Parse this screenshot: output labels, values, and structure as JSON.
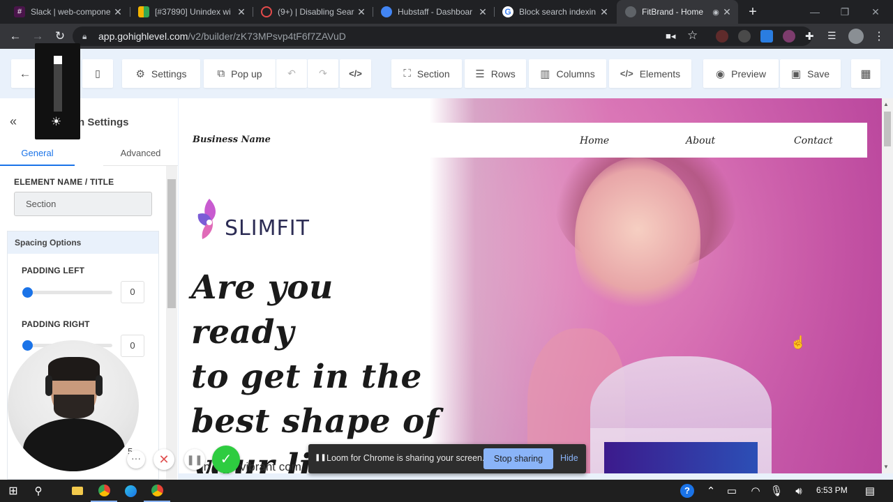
{
  "browser": {
    "tabs": [
      {
        "title": "Slack | web-compone",
        "favicon_color": "#4a154b",
        "active": false
      },
      {
        "title": "[#37890] Unindex wi",
        "favicon_color": "#f4b400",
        "active": false
      },
      {
        "title": "(9+) | Disabling Sear",
        "favicon_color": "#e54b4b",
        "active": false
      },
      {
        "title": "Hubstaff - Dashboar",
        "favicon_color": "#4285f4",
        "active": false
      },
      {
        "title": "Block search indexin",
        "favicon_color": "#ffffff",
        "active": false
      },
      {
        "title": "FitBrand - Home",
        "favicon_color": "#9aa0a6",
        "active": true
      }
    ],
    "url_host": "app.gohighlevel.com",
    "url_path": "/v2/builder/zK73MPsvp4tF6f7ZAVuD"
  },
  "toolbar": {
    "settings": "Settings",
    "popup": "Pop up",
    "section": "Section",
    "rows": "Rows",
    "columns": "Columns",
    "elements": "Elements",
    "preview": "Preview",
    "save": "Save"
  },
  "panel": {
    "title_partial": "n Settings",
    "tab_general": "General",
    "tab_advanced": "Advanced",
    "element_name_label": "ELEMENT NAME / TITLE",
    "element_name_value": "Section",
    "spacing_title": "Spacing Options",
    "padding_left_label": "PADDING LEFT",
    "padding_left_value": "0",
    "padding_right_label": "PADDING RIGHT",
    "padding_right_value": "0",
    "partial_value": "5"
  },
  "page": {
    "business_name": "Business Name",
    "nav_home": "Home",
    "nav_about": "About",
    "nav_contact": "Contact",
    "logo_text": "SLIMFIT",
    "headline_1": "Are you ready",
    "headline_2": "to get in the",
    "headline_3": "best shape of",
    "headline_4": "your life?",
    "subtext_partial": "vibrant com",
    "subtext_prefix": "in"
  },
  "loom": {
    "message": "Loom for Chrome is sharing your screen.",
    "stop_label": "Stop sharing",
    "hide_label": "Hide"
  },
  "taskbar": {
    "time": "6:53 PM"
  },
  "colors": {
    "accent_blue": "#1a73e8",
    "toolbar_bg": "#e9f1fb",
    "loom_bg": "#2d2d2d",
    "loom_button": "#8ab4f8",
    "record_green": "#2ecc40",
    "record_red": "#e05050"
  }
}
